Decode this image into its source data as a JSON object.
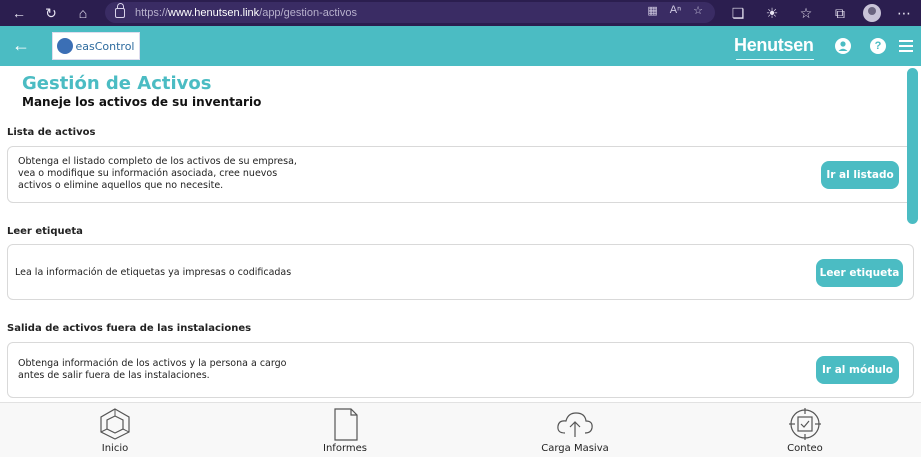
{
  "browser": {
    "url_prefix": "https://",
    "url_host": "www.henutsen.link",
    "url_path": "/app/gestion-activos"
  },
  "header": {
    "logo_text": "easControl",
    "brand": "Henutsen",
    "user_symbol": "●",
    "help_symbol": "?"
  },
  "page": {
    "title": "Gestión de Activos",
    "subtitle": "Maneje los activos de su inventario"
  },
  "sections": [
    {
      "title": "Lista de activos",
      "description": "Obtenga el listado completo de los activos de su empresa, vea o modifique su información asociada, cree nuevos activos o elimine aquellos que no necesite.",
      "button": "Ir al listado"
    },
    {
      "title": "Leer etiqueta",
      "description": "Lea la información de etiquetas ya impresas o codificadas",
      "button": "Leer etiqueta"
    },
    {
      "title": "Salida de activos fuera de las instalaciones",
      "description": "Obtenga información de los activos y la persona a cargo antes de salir fuera de las instalaciones.",
      "button": "Ir al módulo"
    }
  ],
  "bottom_nav": [
    {
      "label": "Inicio",
      "icon": "home-icon"
    },
    {
      "label": "Informes",
      "icon": "document-icon"
    },
    {
      "label": "Carga Masiva",
      "icon": "cloud-upload-icon"
    },
    {
      "label": "Conteo",
      "icon": "target-check-icon"
    }
  ],
  "colors": {
    "accent": "#4bbcc3",
    "browser_bar": "#2b1e4f"
  }
}
